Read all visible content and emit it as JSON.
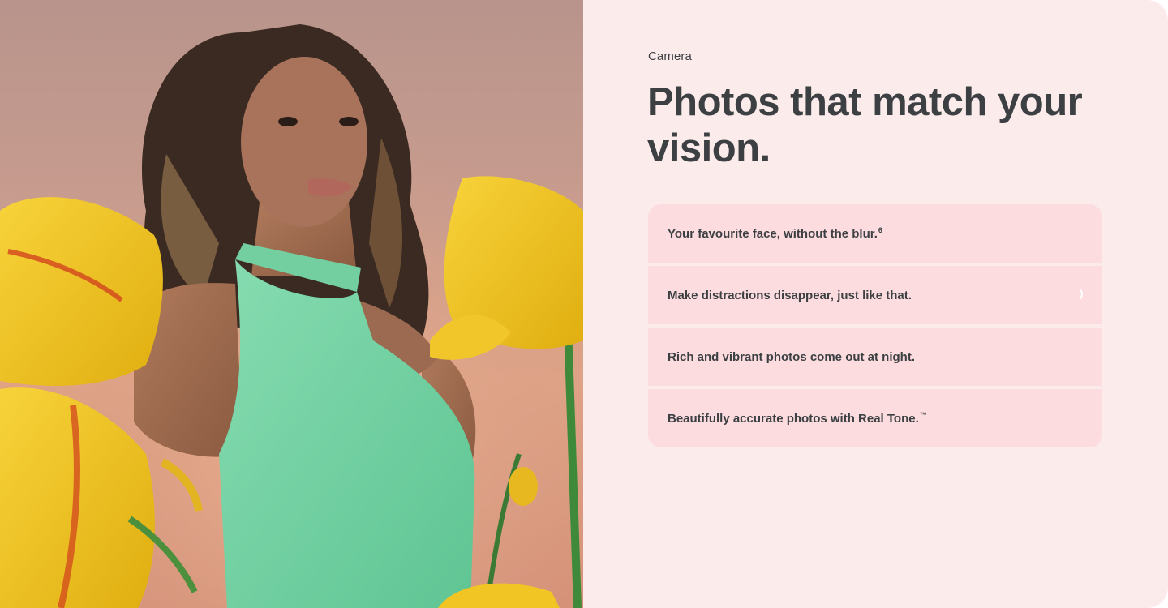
{
  "section": {
    "eyebrow": "Camera",
    "headline": "Photos that match your vision."
  },
  "features": [
    {
      "text": "Your favourite face, without the blur.",
      "sup": "6",
      "active": false
    },
    {
      "text": "Make distractions disappear, just like that.",
      "sup": "",
      "active": true
    },
    {
      "text": "Rich and vibrant photos come out at night.",
      "sup": "",
      "active": false
    },
    {
      "text": "Beautifully accurate photos with Real Tone.",
      "sup": "™",
      "active": false
    }
  ],
  "colors": {
    "panel_background": "#fcebeb",
    "feature_background": "#fddcdf",
    "text": "#3c4043",
    "dress": "#7ed6a8",
    "flower": "#f3c81c"
  },
  "image": {
    "description_icon": "portrait-photo"
  }
}
